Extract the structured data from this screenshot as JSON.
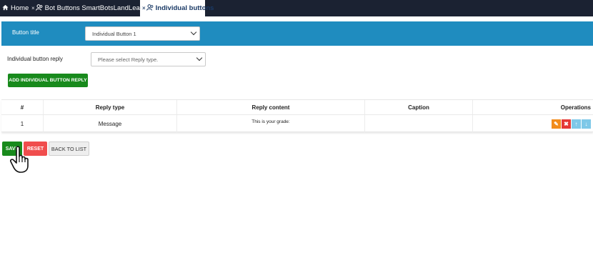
{
  "tabs": [
    {
      "label": "Home",
      "icon": "home-icon"
    },
    {
      "label": "Bot Buttons SmartBotsLandLearning",
      "icon": "users-icon"
    },
    {
      "label": "Individual buttons",
      "icon": "users-icon",
      "active": true
    }
  ],
  "form": {
    "button_title_label": "Button title",
    "button_title_value": "Individual Button 1",
    "reply_label": "Individual button reply",
    "reply_placeholder": "Please select Reply type.",
    "add_reply_button": "ADD INDIVIDUAL BUTTON REPLY"
  },
  "table": {
    "headers": [
      "#",
      "Reply type",
      "Reply content",
      "Caption",
      "Operations"
    ],
    "rows": [
      {
        "index": "1",
        "reply_type": "Message",
        "reply_content": "This is your grade:",
        "caption": ""
      }
    ]
  },
  "actions": {
    "save": "SAVE",
    "reset": "RESET",
    "back": "BACK TO LIST"
  },
  "colors": {
    "topbar": "#1b2232",
    "header_band": "#1f8cbf",
    "green": "#188a1c",
    "red": "#f04d4d",
    "edit": "#f28c1b",
    "move": "#7ec8e8"
  }
}
